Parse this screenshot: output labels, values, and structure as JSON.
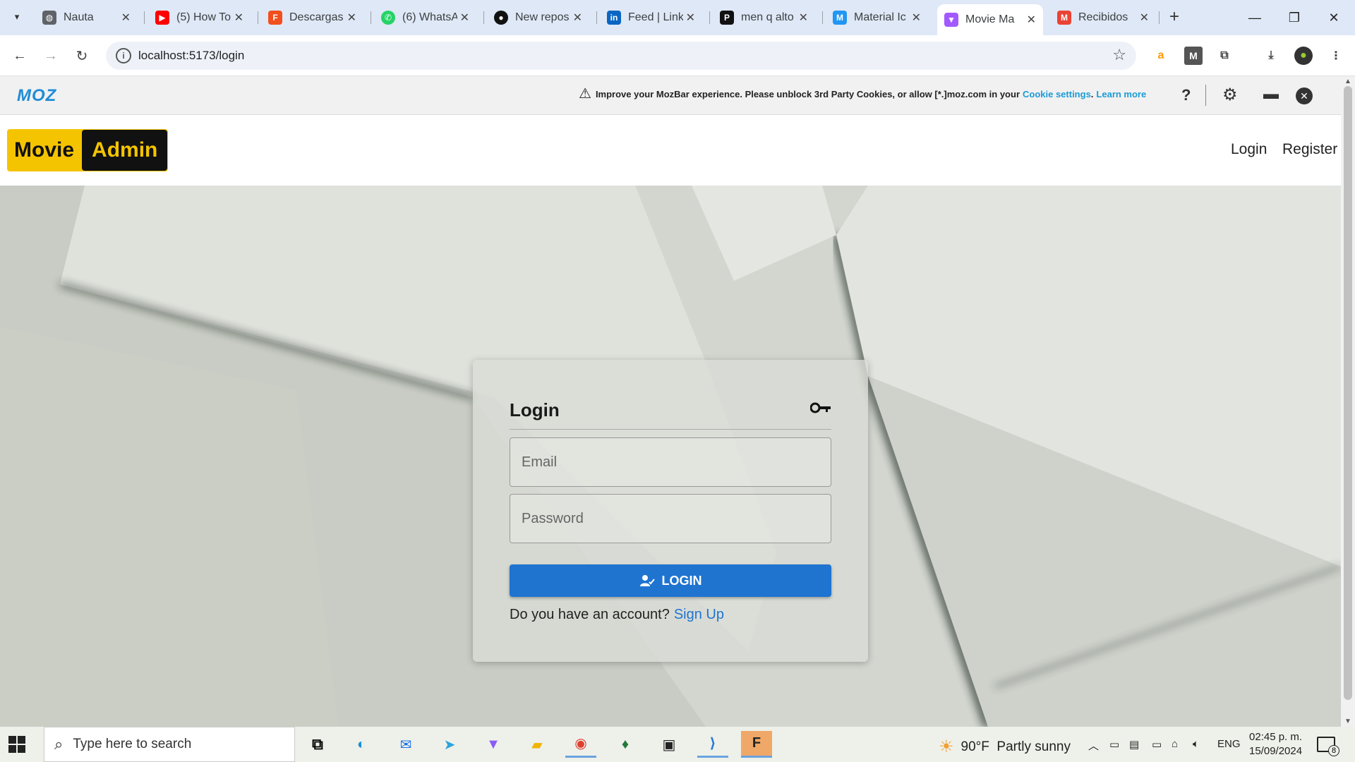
{
  "browser": {
    "tabs": [
      {
        "title": "Nauta",
        "icon": "globe-icon",
        "color": "#5f6368"
      },
      {
        "title": "(5) How To",
        "icon": "youtube-icon",
        "color": "#ff0000"
      },
      {
        "title": "Descargas",
        "icon": "figma-icon",
        "color": "#f24e1e"
      },
      {
        "title": "(6) WhatsA",
        "icon": "whatsapp-icon",
        "color": "#25d366"
      },
      {
        "title": "New repos",
        "icon": "github-icon",
        "color": "#111111"
      },
      {
        "title": "Feed | Link",
        "icon": "linkedin-icon",
        "color": "#0a66c2"
      },
      {
        "title": "men q alto",
        "icon": "pinterest-icon",
        "color": "#111111"
      },
      {
        "title": "Material Ic",
        "icon": "material-icon",
        "color": "#2196f3"
      },
      {
        "title": "Movie Ma",
        "icon": "vite-icon",
        "color": "#a259ff",
        "active": true
      },
      {
        "title": "Recibidos",
        "icon": "gmail-icon",
        "color": "#ea4335"
      }
    ],
    "url": "localhost:5173/login"
  },
  "mozbar": {
    "logo": "MOZ",
    "message": "Improve your MozBar experience. Please unblock 3rd Party Cookies, or allow [*.]moz.com in your",
    "cookie_link": "Cookie settings",
    "period": ".",
    "learn_more": "Learn more",
    "help": "?"
  },
  "app": {
    "logo_part1": "Movie",
    "logo_part2": "Admin",
    "nav": {
      "login": "Login",
      "register": "Register"
    },
    "colors": {
      "brand_yellow": "#f5c400",
      "primary_blue": "#1f74d0"
    }
  },
  "login_form": {
    "title": "Login",
    "email_placeholder": "Email",
    "password_placeholder": "Password",
    "submit_label": "LOGIN",
    "signup_prompt": "Do you have an account?",
    "signup_link": "Sign Up"
  },
  "taskbar": {
    "search_placeholder": "Type here to search",
    "weather_temp": "90°F",
    "weather_text": "Partly sunny",
    "language": "ENG",
    "time": "02:45 p. m.",
    "date": "15/09/2024",
    "notifications": "8"
  }
}
